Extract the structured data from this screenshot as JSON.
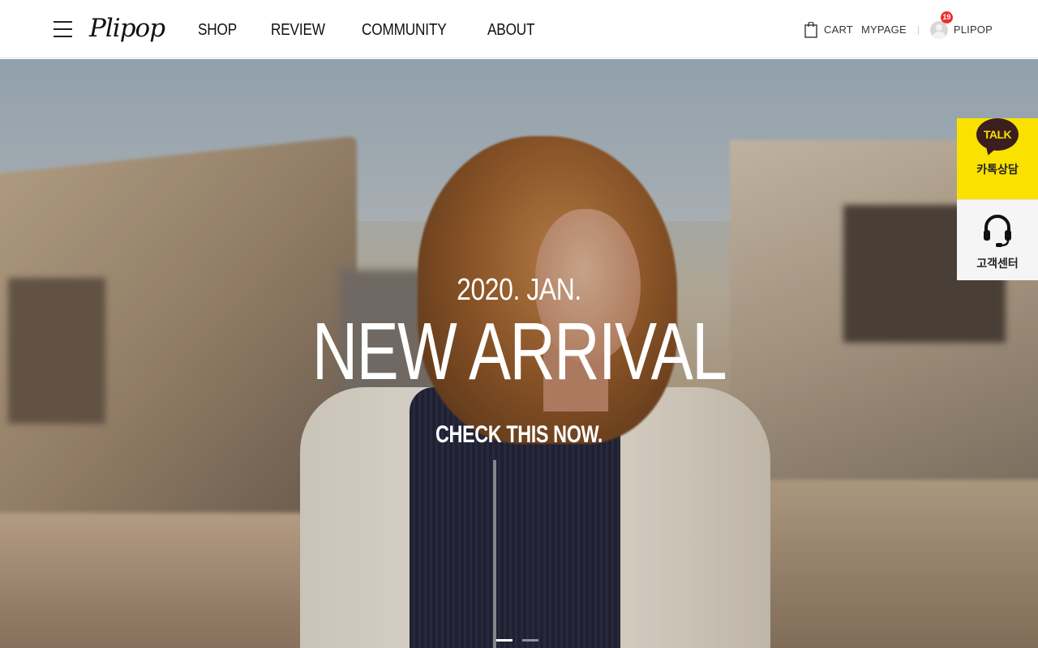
{
  "brand": {
    "logo_text": "Plipop"
  },
  "nav": {
    "items": [
      {
        "label": "SHOP"
      },
      {
        "label": "REVIEW"
      },
      {
        "label": "COMMUNITY"
      },
      {
        "label": "ABOUT"
      }
    ]
  },
  "util": {
    "cart_label": "CART",
    "mypage_label": "MYPAGE",
    "user_name": "PLIPOP",
    "notification_count": "19",
    "badge_color": "#ef2c2c"
  },
  "hero": {
    "date": "2020. JAN.",
    "title": "NEW ARRIVAL",
    "cta": "CHECK THIS NOW.",
    "slides_total": 2,
    "active_slide": 1
  },
  "quick": {
    "kakao_icon_text": "TALK",
    "kakao_label": "카톡상담",
    "kakao_color": "#fae100",
    "cs_label": "고객센터",
    "cs_icon": "headset-icon"
  },
  "icons": {
    "menu": "hamburger-menu-icon",
    "cart": "shopping-bag-icon",
    "avatar": "user-avatar-icon"
  }
}
